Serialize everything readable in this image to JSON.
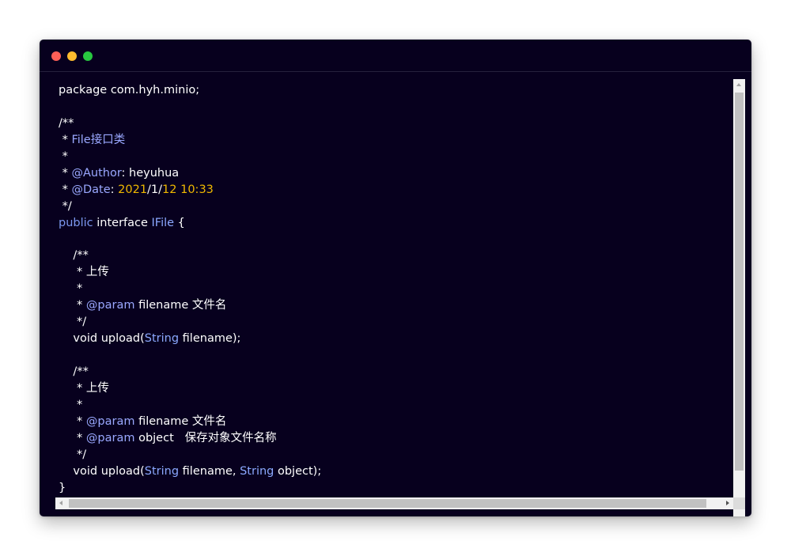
{
  "colors": {
    "background": "#07001e",
    "text": "#ffffff",
    "keyword": "#7c98f0",
    "type": "#8ba8ff",
    "annotation": "#9aa8ff",
    "number": "#f0b800",
    "close_dot": "#fe5f57",
    "minimize_dot": "#febc2e",
    "maximize_dot": "#28c840"
  },
  "window_controls": {
    "close": "close-dot-icon",
    "minimize": "minimize-dot-icon",
    "maximize": "maximize-dot-icon"
  },
  "code": {
    "lines": [
      [
        {
          "t": "package com.hyh.minio;"
        }
      ],
      [],
      [
        {
          "t": "/**"
        }
      ],
      [
        {
          "t": " * "
        },
        {
          "t": "File接口类",
          "c": "tag"
        }
      ],
      [
        {
          "t": " *"
        }
      ],
      [
        {
          "t": " * "
        },
        {
          "t": "@Author",
          "c": "tag"
        },
        {
          "t": ": heyuhua"
        }
      ],
      [
        {
          "t": " * "
        },
        {
          "t": "@Date",
          "c": "tag"
        },
        {
          "t": ": "
        },
        {
          "t": "2021",
          "c": "num"
        },
        {
          "t": "/1/"
        },
        {
          "t": "12",
          "c": "num"
        },
        {
          "t": " "
        },
        {
          "t": "10:33",
          "c": "num"
        }
      ],
      [
        {
          "t": " */"
        }
      ],
      [
        {
          "t": "public",
          "c": "kw"
        },
        {
          "t": " interface "
        },
        {
          "t": "IFile",
          "c": "type"
        },
        {
          "t": " {"
        }
      ],
      [],
      [
        {
          "t": "    /**"
        }
      ],
      [
        {
          "t": "     * 上传"
        }
      ],
      [
        {
          "t": "     *"
        }
      ],
      [
        {
          "t": "     * "
        },
        {
          "t": "@param",
          "c": "tag"
        },
        {
          "t": " filename 文件名"
        }
      ],
      [
        {
          "t": "     */"
        }
      ],
      [
        {
          "t": "    void upload("
        },
        {
          "t": "String",
          "c": "type"
        },
        {
          "t": " filename);"
        }
      ],
      [],
      [
        {
          "t": "    /**"
        }
      ],
      [
        {
          "t": "     * 上传"
        }
      ],
      [
        {
          "t": "     *"
        }
      ],
      [
        {
          "t": "     * "
        },
        {
          "t": "@param",
          "c": "tag"
        },
        {
          "t": " filename 文件名"
        }
      ],
      [
        {
          "t": "     * "
        },
        {
          "t": "@param",
          "c": "tag"
        },
        {
          "t": " object   保存对象文件名称"
        }
      ],
      [
        {
          "t": "     */"
        }
      ],
      [
        {
          "t": "    void upload("
        },
        {
          "t": "String",
          "c": "type"
        },
        {
          "t": " filename, "
        },
        {
          "t": "String",
          "c": "type"
        },
        {
          "t": " object);"
        }
      ],
      [
        {
          "t": "}"
        }
      ]
    ]
  }
}
